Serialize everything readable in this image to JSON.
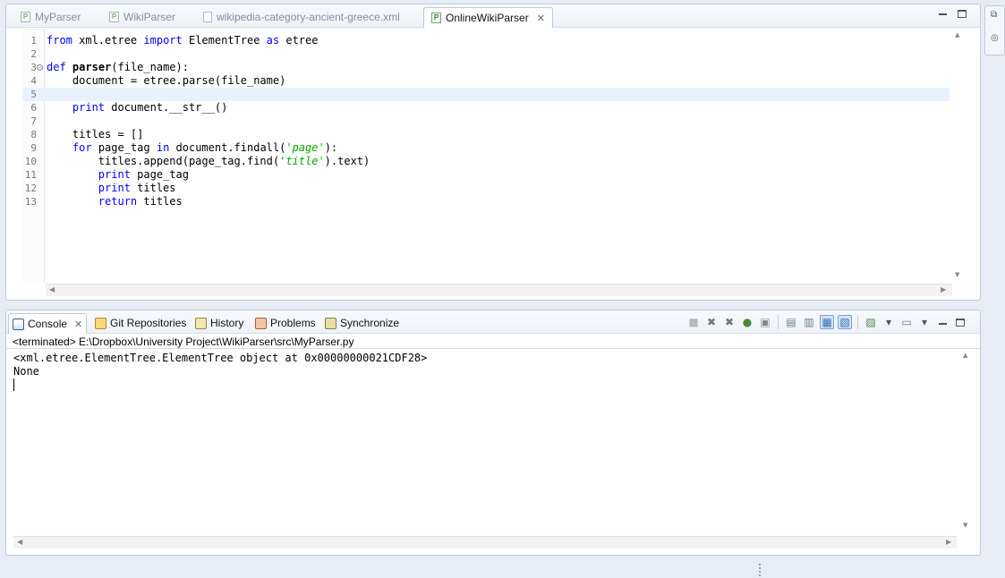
{
  "editor": {
    "tabs": [
      {
        "label": "MyParser",
        "icon": "python-file-icon"
      },
      {
        "label": "WikiParser",
        "icon": "python-file-icon"
      },
      {
        "label": "wikipedia-category-ancient-greece.xml",
        "icon": "xml-file-icon"
      },
      {
        "label": "OnlineWikiParser",
        "icon": "python-file-icon",
        "active": true
      }
    ],
    "lines": [
      {
        "n": "1",
        "tokens": [
          [
            "kw",
            "from"
          ],
          [
            "t",
            " xml.etree "
          ],
          [
            "kw",
            "import"
          ],
          [
            "t",
            " ElementTree "
          ],
          [
            "kw",
            "as"
          ],
          [
            "t",
            " etree"
          ]
        ]
      },
      {
        "n": "2",
        "tokens": []
      },
      {
        "n": "3",
        "fold": true,
        "tokens": [
          [
            "kwb",
            "def"
          ],
          [
            "t",
            " "
          ],
          [
            "fn",
            "parser"
          ],
          [
            "t",
            "(file_name):"
          ]
        ]
      },
      {
        "n": "4",
        "tokens": [
          [
            "t",
            "    document = etree.parse(file_name)"
          ]
        ]
      },
      {
        "n": "5",
        "current": true,
        "tokens": []
      },
      {
        "n": "6",
        "tokens": [
          [
            "t",
            "    "
          ],
          [
            "kw",
            "print"
          ],
          [
            "t",
            " document.__str__()"
          ]
        ]
      },
      {
        "n": "7",
        "tokens": []
      },
      {
        "n": "8",
        "tokens": [
          [
            "t",
            "    titles = []"
          ]
        ]
      },
      {
        "n": "9",
        "tokens": [
          [
            "t",
            "    "
          ],
          [
            "kw",
            "for"
          ],
          [
            "t",
            " page_tag "
          ],
          [
            "kw",
            "in"
          ],
          [
            "t",
            " document.findall("
          ],
          [
            "str",
            "'page'"
          ],
          [
            "t",
            "):"
          ]
        ]
      },
      {
        "n": "10",
        "tokens": [
          [
            "t",
            "        titles.append(page_tag.find("
          ],
          [
            "str",
            "'title'"
          ],
          [
            "t",
            ").text)"
          ]
        ]
      },
      {
        "n": "11",
        "tokens": [
          [
            "t",
            "        "
          ],
          [
            "kw",
            "print"
          ],
          [
            "t",
            " page_tag"
          ]
        ]
      },
      {
        "n": "12",
        "tokens": [
          [
            "t",
            "        "
          ],
          [
            "kw",
            "print"
          ],
          [
            "t",
            " titles"
          ]
        ]
      },
      {
        "n": "13",
        "tokens": [
          [
            "t",
            "        "
          ],
          [
            "kw",
            "return"
          ],
          [
            "t",
            " titles"
          ]
        ]
      }
    ]
  },
  "views": {
    "tabs": [
      {
        "label": "Console",
        "icon": "console-icon",
        "active": true
      },
      {
        "label": "Git Repositories",
        "icon": "git-repositories-icon"
      },
      {
        "label": "History",
        "icon": "history-icon"
      },
      {
        "label": "Problems",
        "icon": "problems-icon"
      },
      {
        "label": "Synchronize",
        "icon": "synchronize-icon"
      }
    ],
    "close_glyph": "✕",
    "toolbar": [
      "■",
      "✖",
      "✖",
      "●",
      "▣",
      "▤",
      "▥",
      "▦",
      "▧",
      "▨",
      "▾",
      "▭",
      "▾"
    ]
  },
  "console": {
    "status": "<terminated> E:\\Dropbox\\University Project\\WikiParser\\src\\MyParser.py",
    "output": "<xml.etree.ElementTree.ElementTree object at 0x00000000021CDF28>\nNone"
  }
}
